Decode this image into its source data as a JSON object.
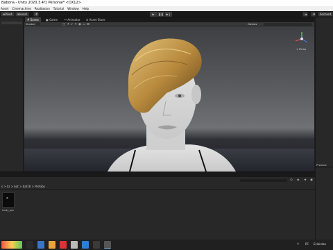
{
  "window": {
    "title": "Babona - Unity 2020.3.4f1 Personal* <DX12>"
  },
  "menubar": [
    "Asset",
    "Cinemachine",
    "Realtoxion",
    "Tutorial",
    "Window",
    "Help"
  ],
  "toolbar": {
    "pivot_label": "Pivot",
    "local_label": "Local",
    "play_icon": "▶",
    "pause_icon": "❚❚",
    "step_icon": "▶❘",
    "account_label": "Account"
  },
  "view_tabs": {
    "scene": "Scene",
    "game": "Game",
    "animator": "Animator",
    "asset_store": "Asset Store"
  },
  "inspector": {
    "label": "Inspector"
  },
  "scene_toolbar": {
    "shading_mode": "Shaded",
    "gizmos": "Gizmos",
    "persp_label": "< Persp"
  },
  "preview": {
    "label": "Preview"
  },
  "project": {
    "breadcrumb": "s > liz > bat > bat16 > Prefabs",
    "asset_label": "Unity_bio"
  },
  "taskbar": {
    "lang": "PC",
    "user": "Eclairdes"
  },
  "colors": {
    "accent": "#3a72b0",
    "hair": "#b88a3e",
    "skin": "#d6d6d6"
  }
}
